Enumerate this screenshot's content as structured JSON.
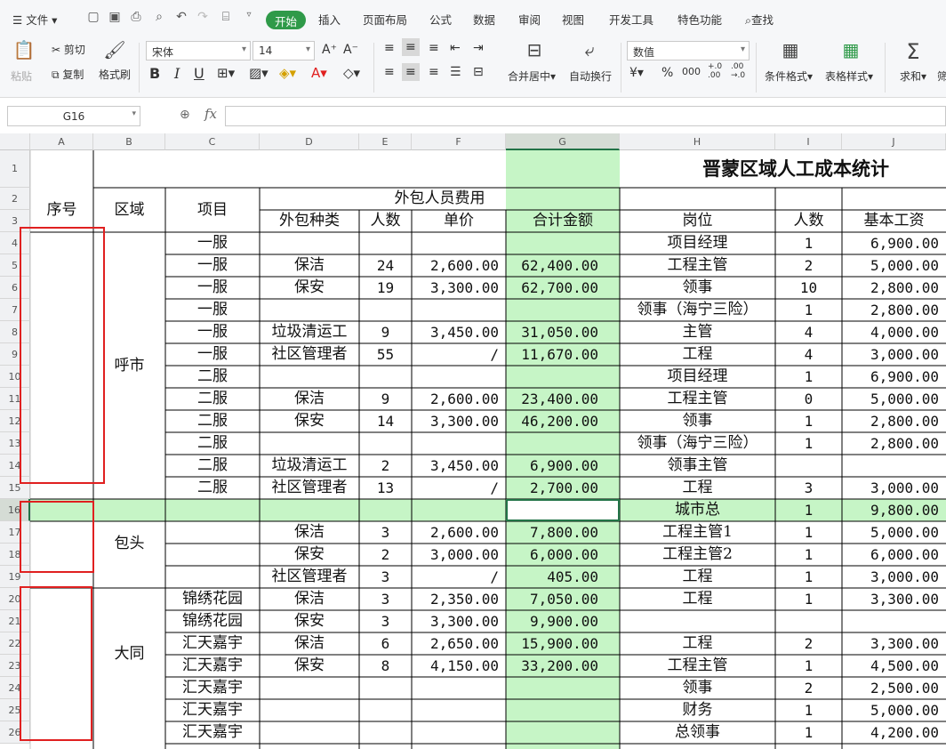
{
  "menubar": {
    "file": "文件",
    "tabs": [
      "开始",
      "插入",
      "页面布局",
      "公式",
      "数据",
      "审阅",
      "视图",
      "开发工具",
      "特色功能"
    ],
    "search": "查找"
  },
  "ribbon": {
    "paste": "粘贴",
    "cut": "剪切",
    "copy": "复制",
    "format_painter": "格式刷",
    "font_name": "宋体",
    "font_size": "14",
    "grow": "A⁺",
    "shrink": "A⁻",
    "bold": "B",
    "italic": "I",
    "underline": "U",
    "merge_center": "合并居中",
    "wrap": "自动换行",
    "number_format": "数值",
    "currency": "¥",
    "percent": "%",
    "thousands": "000",
    "inc_dec": "+.0 .00",
    "dec_dec": ".00 →.0",
    "cond_format": "条件格式",
    "table_style": "表格样式",
    "sum": "求和",
    "filter": "筛"
  },
  "formula_bar": {
    "name_box": "G16",
    "fx": "fx",
    "formula": ""
  },
  "columns": [
    "A",
    "B",
    "C",
    "D",
    "E",
    "F",
    "G",
    "H",
    "I",
    "J"
  ],
  "rows": [
    "1",
    "2",
    "3",
    "4",
    "5",
    "6",
    "7",
    "8",
    "9",
    "10",
    "11",
    "12",
    "13",
    "14",
    "15",
    "16",
    "17",
    "18",
    "19",
    "20",
    "21",
    "22",
    "23",
    "24",
    "25",
    "26"
  ],
  "sheet": {
    "title": "晋蒙区域人工成本统计",
    "headers": {
      "seq": "序号",
      "region": "区域",
      "project": "项目",
      "outsource_group": "外包人员费用",
      "type": "外包种类",
      "count": "人数",
      "price": "单价",
      "total": "合计金额",
      "post": "岗位",
      "staff_count": "人数",
      "base_wage": "基本工资"
    },
    "regions": {
      "huhe": "呼市",
      "baotou": "包头",
      "datong": "大同"
    },
    "rows": [
      {
        "c": "一服",
        "d": "",
        "e": "",
        "f": "",
        "g": "",
        "h": "项目经理",
        "i": "1",
        "j": "6,900.00"
      },
      {
        "c": "一服",
        "d": "保洁",
        "e": "24",
        "f": "2,600.00",
        "g": "62,400.00",
        "h": "工程主管",
        "i": "2",
        "j": "5,000.00"
      },
      {
        "c": "一服",
        "d": "保安",
        "e": "19",
        "f": "3,300.00",
        "g": "62,700.00",
        "h": "领事",
        "i": "10",
        "j": "2,800.00"
      },
      {
        "c": "一服",
        "d": "",
        "e": "",
        "f": "",
        "g": "",
        "h": "领事（海宁三险）",
        "i": "1",
        "j": "2,800.00"
      },
      {
        "c": "一服",
        "d": "垃圾清运工",
        "e": "9",
        "f": "3,450.00",
        "g": "31,050.00",
        "h": "主管",
        "i": "4",
        "j": "4,000.00"
      },
      {
        "c": "一服",
        "d": "社区管理者",
        "e": "55",
        "f": "/",
        "g": "11,670.00",
        "h": "工程",
        "i": "4",
        "j": "3,000.00"
      },
      {
        "c": "二服",
        "d": "",
        "e": "",
        "f": "",
        "g": "",
        "h": "项目经理",
        "i": "1",
        "j": "6,900.00"
      },
      {
        "c": "二服",
        "d": "保洁",
        "e": "9",
        "f": "2,600.00",
        "g": "23,400.00",
        "h": "工程主管",
        "i": "0",
        "j": "5,000.00"
      },
      {
        "c": "二服",
        "d": "保安",
        "e": "14",
        "f": "3,300.00",
        "g": "46,200.00",
        "h": "领事",
        "i": "1",
        "j": "2,800.00"
      },
      {
        "c": "二服",
        "d": "",
        "e": "",
        "f": "",
        "g": "",
        "h": "领事（海宁三险）",
        "i": "1",
        "j": "2,800.00"
      },
      {
        "c": "二服",
        "d": "垃圾清运工",
        "e": "2",
        "f": "3,450.00",
        "g": "6,900.00",
        "h": "领事主管",
        "i": "",
        "j": ""
      },
      {
        "c": "二服",
        "d": "社区管理者",
        "e": "13",
        "f": "/",
        "g": "2,700.00",
        "h": "工程",
        "i": "3",
        "j": "3,000.00"
      },
      {
        "c": "",
        "d": "",
        "e": "",
        "f": "",
        "g": "",
        "h": "城市总",
        "i": "1",
        "j": "9,800.00"
      },
      {
        "c": "",
        "d": "保洁",
        "e": "3",
        "f": "2,600.00",
        "g": "7,800.00",
        "h": "工程主管1",
        "i": "1",
        "j": "5,000.00"
      },
      {
        "c": "",
        "d": "保安",
        "e": "2",
        "f": "3,000.00",
        "g": "6,000.00",
        "h": "工程主管2",
        "i": "1",
        "j": "6,000.00"
      },
      {
        "c": "",
        "d": "社区管理者",
        "e": "3",
        "f": "/",
        "g": "405.00",
        "h": "工程",
        "i": "1",
        "j": "3,000.00"
      },
      {
        "c": "锦绣花园",
        "d": "保洁",
        "e": "3",
        "f": "2,350.00",
        "g": "7,050.00",
        "h": "工程",
        "i": "1",
        "j": "3,300.00"
      },
      {
        "c": "锦绣花园",
        "d": "保安",
        "e": "3",
        "f": "3,300.00",
        "g": "9,900.00",
        "h": "",
        "i": "",
        "j": ""
      },
      {
        "c": "汇天嘉宇",
        "d": "保洁",
        "e": "6",
        "f": "2,650.00",
        "g": "15,900.00",
        "h": "工程",
        "i": "2",
        "j": "3,300.00"
      },
      {
        "c": "汇天嘉宇",
        "d": "保安",
        "e": "8",
        "f": "4,150.00",
        "g": "33,200.00",
        "h": "工程主管",
        "i": "1",
        "j": "4,500.00"
      },
      {
        "c": "汇天嘉宇",
        "d": "",
        "e": "",
        "f": "",
        "g": "",
        "h": "领事",
        "i": "2",
        "j": "2,500.00"
      },
      {
        "c": "汇天嘉宇",
        "d": "",
        "e": "",
        "f": "",
        "g": "",
        "h": "财务",
        "i": "1",
        "j": "5,000.00"
      },
      {
        "c": "汇天嘉宇",
        "d": "",
        "e": "",
        "f": "",
        "g": "",
        "h": "总领事",
        "i": "1",
        "j": "4,200.00"
      }
    ]
  },
  "colors": {
    "accent": "#2f9a49",
    "highlight_green": "#c6f5c6",
    "annotation_red": "#e02020",
    "selected_border": "#217346"
  }
}
